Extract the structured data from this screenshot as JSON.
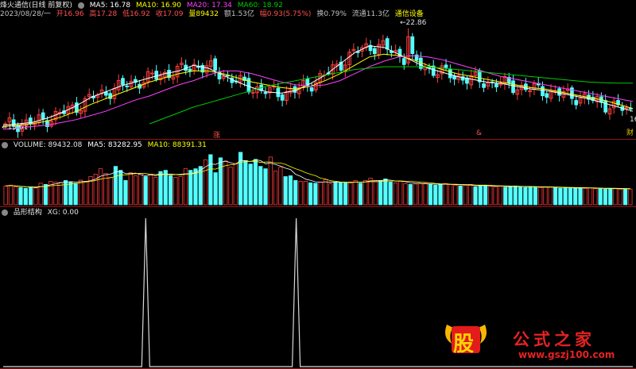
{
  "main_header": {
    "title": "烽火通信(日线 前复权)",
    "ma5": "MA5: 16.78",
    "ma10": "MA10: 16.90",
    "ma20": "MA20: 17.34",
    "ma60": "MA60: 18.92"
  },
  "info_row": {
    "date": "2023/08/28/一",
    "open": "开16.96",
    "high": "高17.28",
    "low": "低16.92",
    "close": "收17.09",
    "vol": "量89432",
    "amount": "额1.53亿",
    "change": "幅0.93(5.75%)",
    "turnover": "换0.79%",
    "float": "流通11.3亿",
    "sector": "通信设备"
  },
  "price_chart": {
    "high_label": "22.86",
    "low_label": "15.61",
    "right_label": "16",
    "right_tag": "财",
    "marker_zhang": "涨",
    "marker_tag": "&"
  },
  "volume_header": {
    "volume": "VOLUME: 89432.08",
    "ma5": "MA5: 83282.95",
    "ma10": "MA10: 88391.31"
  },
  "indicator_header": {
    "name": "品形结构",
    "xg": "XG: 0.00"
  },
  "watermark": {
    "logo_char": "股",
    "site_name": "公式之家",
    "url": "www.gszj100.com"
  },
  "colors": {
    "up": "#ff3c3c",
    "down": "#54ffff",
    "ma5": "#ffffff",
    "ma10": "#ffff00",
    "ma20": "#ff40ff",
    "ma60": "#00cc00",
    "indicator": "#d8d8d8"
  },
  "chart_data": [
    {
      "type": "candlestick",
      "series": [
        {
          "name": "MA5",
          "values": [
            15.9,
            16.0,
            16.1,
            16.4,
            16.8,
            17.3,
            17.9,
            18.3,
            18.7,
            19.0,
            19.3,
            19.6,
            19.8,
            20.2,
            20.0,
            19.5,
            19.0,
            18.6,
            18.3,
            18.2,
            18.4,
            18.9,
            19.5,
            20.3,
            21.1,
            21.6,
            21.5,
            21.0,
            20.5,
            20.0,
            19.7,
            19.4,
            19.2,
            19.0,
            18.9,
            18.7,
            18.5,
            18.4,
            18.2,
            18.0,
            17.8,
            17.5,
            17.2,
            16.9
          ]
        },
        {
          "name": "MA10",
          "values": [
            15.8,
            15.9,
            16.0,
            16.2,
            16.5,
            16.9,
            17.4,
            17.8,
            18.2,
            18.6,
            19.0,
            19.3,
            19.6,
            19.8,
            19.8,
            19.6,
            19.3,
            19.0,
            18.8,
            18.6,
            18.5,
            18.7,
            19.1,
            19.6,
            20.2,
            20.8,
            21.0,
            20.9,
            20.6,
            20.2,
            19.9,
            19.6,
            19.4,
            19.2,
            19.0,
            18.8,
            18.6,
            18.5,
            18.3,
            18.1,
            17.9,
            17.7,
            17.4,
            17.1
          ]
        },
        {
          "name": "MA20",
          "values": [
            15.6,
            15.7,
            15.8,
            15.9,
            16.1,
            16.3,
            16.6,
            16.9,
            17.3,
            17.7,
            18.0,
            18.4,
            18.8,
            19.1,
            19.5,
            19.8,
            19.8,
            19.6,
            19.3,
            19.0,
            18.8,
            18.7,
            18.8,
            19.1,
            19.6,
            20.1,
            20.5,
            20.8,
            20.9,
            20.8,
            20.6,
            20.3,
            20.0,
            19.7,
            19.4,
            19.2,
            19.0,
            18.8,
            18.6,
            18.4,
            18.2,
            18.0,
            17.8,
            17.6
          ]
        },
        {
          "name": "MA60",
          "values": [
            null,
            null,
            null,
            null,
            null,
            null,
            null,
            null,
            null,
            null,
            16.0,
            16.4,
            16.8,
            17.2,
            17.5,
            17.8,
            18.1,
            18.4,
            18.7,
            18.9,
            19.1,
            19.3,
            19.5,
            19.7,
            19.9,
            20.0,
            20.1,
            20.1,
            20.1,
            20.1,
            20.0,
            19.9,
            19.8,
            19.7,
            19.6,
            19.5,
            19.4,
            19.3,
            19.2,
            19.1,
            19.0,
            18.95,
            18.92,
            18.92
          ]
        }
      ],
      "high": 22.86,
      "low": 15.61
    },
    {
      "type": "bar",
      "title": "VOLUME",
      "values": [
        48,
        50,
        46,
        44,
        42,
        45,
        43,
        55,
        52,
        60,
        58,
        57,
        62,
        58,
        55,
        63,
        60,
        72,
        78,
        92,
        80,
        70,
        98,
        88,
        62,
        82,
        74,
        80,
        72,
        76,
        70,
        85,
        88,
        74,
        70,
        72,
        92,
        88,
        92,
        98,
        115,
        128,
        82,
        120,
        112,
        96,
        106,
        134,
        113,
        104,
        116,
        98,
        92,
        122,
        86,
        96,
        72,
        74,
        62,
        60,
        60,
        56,
        55,
        58,
        64,
        54,
        58,
        56,
        56,
        58,
        62,
        55,
        62,
        68,
        60,
        62,
        66,
        58,
        56,
        60,
        54,
        52,
        53,
        54,
        55,
        52,
        50,
        52,
        54,
        52,
        50,
        48,
        50,
        52,
        46,
        48,
        50,
        47,
        46,
        48,
        45,
        46,
        48,
        47,
        44,
        46,
        45,
        44,
        46,
        45,
        44,
        42,
        44,
        43,
        42,
        44,
        42,
        43,
        41,
        42,
        40,
        41,
        42,
        40,
        41,
        40
      ],
      "ma5": 83282.95,
      "ma10": 88391.31
    },
    {
      "type": "line",
      "title": "品形结构",
      "values": [
        0,
        0,
        0,
        0,
        0,
        0,
        0,
        0,
        0,
        0,
        0,
        0,
        0,
        0,
        0,
        0,
        0,
        0,
        0,
        0,
        0,
        0,
        0,
        0,
        0,
        0,
        0,
        0,
        0,
        0,
        0,
        0,
        0,
        0,
        0,
        0,
        1,
        0,
        0,
        0,
        0,
        0,
        0,
        0,
        0,
        0,
        0,
        0,
        0,
        0,
        0,
        0,
        0,
        0,
        0,
        0,
        0,
        0,
        0,
        0,
        0,
        0,
        0,
        0,
        0,
        0,
        0,
        0,
        0,
        0,
        0,
        0,
        0,
        0,
        1,
        0,
        0,
        0,
        0,
        0,
        0,
        0,
        0,
        0,
        0,
        0,
        0,
        0,
        0,
        0,
        0,
        0,
        0,
        0,
        0,
        0,
        0,
        0,
        0,
        0,
        0,
        0,
        0,
        0,
        0,
        0,
        0,
        0,
        0,
        0,
        0,
        0,
        0,
        0,
        0,
        0,
        0,
        0,
        0,
        0,
        0,
        0,
        0,
        0,
        0,
        0,
        0,
        0,
        0,
        0,
        0,
        0,
        0,
        0,
        0,
        0,
        0,
        0,
        0,
        0,
        0,
        0,
        0,
        0,
        0,
        0,
        0,
        0,
        0,
        0,
        0,
        0,
        0,
        0,
        0,
        0,
        0,
        0,
        0,
        0
      ],
      "ylim": [
        0,
        1
      ]
    }
  ]
}
